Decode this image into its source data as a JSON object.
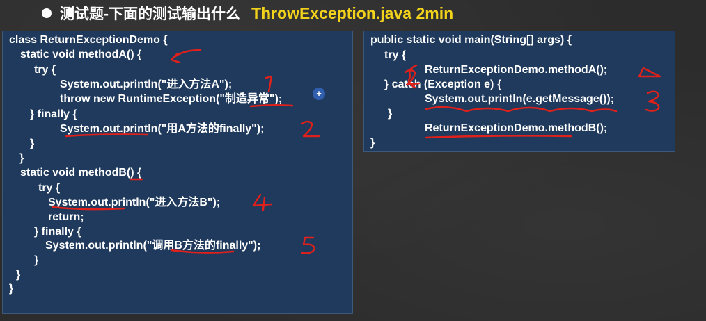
{
  "title": {
    "main": "测试题-下面的测试输出什么",
    "file": "ThrowException.java 2min"
  },
  "left_code": [
    "class ReturnExceptionDemo {",
    "static void methodA() {",
    "try {",
    "System.out.println(\"进入方法A\");",
    "throw new RuntimeException(\"制造异常\");",
    "} finally {",
    "System.out.println(\"用A方法的finally\");",
    "}",
    "}",
    "static void methodB() {",
    "try {",
    "System.out.println(\"进入方法B\");",
    "return;",
    "} finally {",
    "System.out.println(\"调用B方法的finally\");",
    "}",
    "}",
    "}"
  ],
  "right_code": [
    "public static void main(String[] args) {",
    "try {",
    "ReturnExceptionDemo.methodA();",
    "} catch (Exception e) {",
    "System.out.println(e.getMessage());",
    "}",
    "ReturnExceptionDemo.methodB();",
    "}"
  ],
  "annotations": {
    "left_numbers": [
      "1",
      "2",
      "4",
      "5"
    ],
    "right_numbers": [
      "2",
      "3"
    ]
  },
  "cursor": "+",
  "colors": {
    "background": "#2c2c2c",
    "panel": "#1f3a5c",
    "title_accent": "#f2d21b",
    "annotation": "#e0201a"
  }
}
